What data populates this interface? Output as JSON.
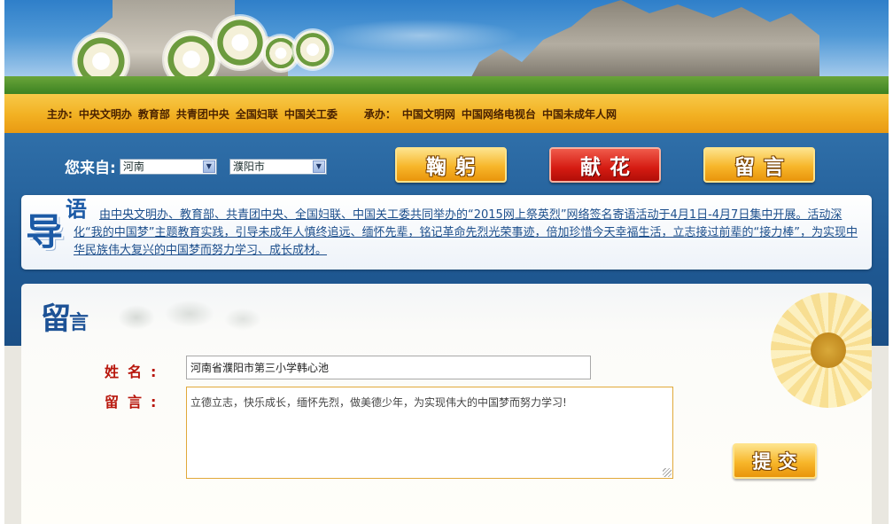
{
  "sponsor": {
    "host_label": "主办:",
    "hosts": [
      "中央文明办",
      "教育部",
      "共青团中央",
      "全国妇联",
      "中国关工委"
    ],
    "organizer_label": "承办：",
    "organizers": [
      "中国文明网",
      "中国网络电视台",
      "中国未成年人网"
    ]
  },
  "from": {
    "label": "您来自:",
    "province": "河南",
    "city": "濮阳市"
  },
  "actions": {
    "bow": "鞠躬",
    "flower": "献花",
    "message": "留言"
  },
  "guide": {
    "logo_main": "导",
    "logo_sub": "语",
    "text": "由中央文明办、教育部、共青团中央、全国妇联、中国关工委共同举办的“2015网上祭英烈”网络签名寄语活动于4月1日-4月7日集中开展。活动深化“我的中国梦”主题教育实践，引导未成年人慎终追远、缅怀先辈，铭记革命先烈光荣事迹，倍加珍惜今天幸福生活，立志接过前辈的“接力棒”，为实现中华民族伟大复兴的中国梦而努力学习、成长成材。"
  },
  "form": {
    "title_big": "留",
    "title_small": "言",
    "name_label": "姓名:",
    "name_value": "河南省濮阳市第三小学韩心池",
    "message_label": "留言:",
    "message_value": "立德立志，快乐成长，缅怀先烈，做美德少年，为实现伟大的中国梦而努力学习!",
    "submit": "提交"
  },
  "colors": {
    "accent_blue": "#1f5993",
    "gold": "#f2b022",
    "red": "#d51b12"
  }
}
